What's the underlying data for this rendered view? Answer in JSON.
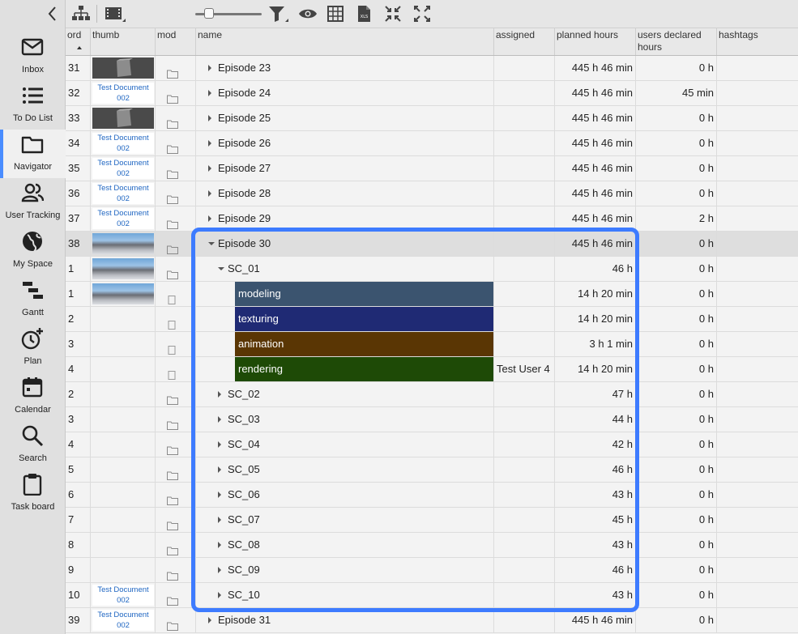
{
  "sidebar": {
    "items": [
      {
        "label": "Inbox",
        "icon": "mail-icon"
      },
      {
        "label": "To Do List",
        "icon": "list-icon"
      },
      {
        "label": "Navigator",
        "icon": "folder-icon",
        "active": true
      },
      {
        "label": "User Tracking",
        "icon": "users-icon"
      },
      {
        "label": "My Space",
        "icon": "globe-icon"
      },
      {
        "label": "Gantt",
        "icon": "gantt-icon"
      },
      {
        "label": "Plan",
        "icon": "clock-plus-icon"
      },
      {
        "label": "Calendar",
        "icon": "calendar-icon"
      },
      {
        "label": "Search",
        "icon": "search-icon"
      },
      {
        "label": "Task board",
        "icon": "clipboard-icon"
      }
    ]
  },
  "toolbar": {
    "icons": [
      "hierarchy-icon",
      "filmstrip-icon",
      "zoom-slider",
      "filter-icon",
      "eye-icon",
      "table-icon",
      "xls-icon",
      "compress-icon",
      "expand-icon"
    ],
    "slider_value": 0.15
  },
  "columns": {
    "ord": "ord",
    "thumb": "thumb",
    "mod": "mod",
    "name": "name",
    "assigned": "assigned",
    "planned": "planned hours",
    "declared_1": "users declared",
    "declared_2": "hours",
    "hashtags": "hashtags"
  },
  "thumb_doc_text": [
    "Test Document",
    "002"
  ],
  "rows": [
    {
      "ord": "31",
      "thumb": "gray",
      "name": "Episode 23",
      "level": 0,
      "exp": "r",
      "assigned": "",
      "planned": "445 h 46 min",
      "declared": "0 h"
    },
    {
      "ord": "32",
      "thumb": "doc",
      "name": "Episode 24",
      "level": 0,
      "exp": "r",
      "assigned": "",
      "planned": "445 h 46 min",
      "declared": "45 min"
    },
    {
      "ord": "33",
      "thumb": "gray",
      "name": "Episode 25",
      "level": 0,
      "exp": "r",
      "assigned": "",
      "planned": "445 h 46 min",
      "declared": "0 h"
    },
    {
      "ord": "34",
      "thumb": "doc",
      "name": "Episode 26",
      "level": 0,
      "exp": "r",
      "assigned": "",
      "planned": "445 h 46 min",
      "declared": "0 h"
    },
    {
      "ord": "35",
      "thumb": "doc",
      "name": "Episode 27",
      "level": 0,
      "exp": "r",
      "assigned": "",
      "planned": "445 h 46 min",
      "declared": "0 h"
    },
    {
      "ord": "36",
      "thumb": "doc",
      "name": "Episode 28",
      "level": 0,
      "exp": "r",
      "assigned": "",
      "planned": "445 h 46 min",
      "declared": "0 h"
    },
    {
      "ord": "37",
      "thumb": "doc",
      "name": "Episode 29",
      "level": 0,
      "exp": "r",
      "assigned": "",
      "planned": "445 h 46 min",
      "declared": "2 h"
    },
    {
      "ord": "38",
      "thumb": "photo",
      "name": "Episode 30",
      "level": 0,
      "exp": "d",
      "assigned": "",
      "planned": "445 h 46 min",
      "declared": "0 h",
      "selected": true
    },
    {
      "ord": "1",
      "thumb": "photo",
      "name": "SC_01",
      "level": 1,
      "exp": "d",
      "assigned": "",
      "planned": "46 h",
      "declared": "0 h"
    },
    {
      "ord": "1",
      "thumb": "photo",
      "name": "modeling",
      "level": 2,
      "task_color": "#3b546f",
      "assigned": "",
      "planned": "14 h 20 min",
      "declared": "0 h"
    },
    {
      "ord": "2",
      "thumb": "",
      "name": "texturing",
      "level": 2,
      "task_color": "#1f2a74",
      "assigned": "",
      "planned": "14 h 20 min",
      "declared": "0 h"
    },
    {
      "ord": "3",
      "thumb": "",
      "name": "animation",
      "level": 2,
      "task_color": "#5a3604",
      "assigned": "",
      "planned": "3 h 1 min",
      "declared": "0 h"
    },
    {
      "ord": "4",
      "thumb": "",
      "name": "rendering",
      "level": 2,
      "task_color": "#1e4a06",
      "assigned": "Test User 4",
      "planned": "14 h 20 min",
      "declared": "0 h"
    },
    {
      "ord": "2",
      "thumb": "",
      "name": "SC_02",
      "level": 1,
      "exp": "r",
      "assigned": "",
      "planned": "47 h",
      "declared": "0 h"
    },
    {
      "ord": "3",
      "thumb": "",
      "name": "SC_03",
      "level": 1,
      "exp": "r",
      "assigned": "",
      "planned": "44 h",
      "declared": "0 h"
    },
    {
      "ord": "4",
      "thumb": "",
      "name": "SC_04",
      "level": 1,
      "exp": "r",
      "assigned": "",
      "planned": "42 h",
      "declared": "0 h"
    },
    {
      "ord": "5",
      "thumb": "",
      "name": "SC_05",
      "level": 1,
      "exp": "r",
      "assigned": "",
      "planned": "46 h",
      "declared": "0 h"
    },
    {
      "ord": "6",
      "thumb": "",
      "name": "SC_06",
      "level": 1,
      "exp": "r",
      "assigned": "",
      "planned": "43 h",
      "declared": "0 h"
    },
    {
      "ord": "7",
      "thumb": "",
      "name": "SC_07",
      "level": 1,
      "exp": "r",
      "assigned": "",
      "planned": "45 h",
      "declared": "0 h"
    },
    {
      "ord": "8",
      "thumb": "",
      "name": "SC_08",
      "level": 1,
      "exp": "r",
      "assigned": "",
      "planned": "43 h",
      "declared": "0 h"
    },
    {
      "ord": "9",
      "thumb": "",
      "name": "SC_09",
      "level": 1,
      "exp": "r",
      "assigned": "",
      "planned": "46 h",
      "declared": "0 h"
    },
    {
      "ord": "10",
      "thumb": "doc",
      "name": "SC_10",
      "level": 1,
      "exp": "r",
      "assigned": "",
      "planned": "43 h",
      "declared": "0 h"
    },
    {
      "ord": "39",
      "thumb": "doc",
      "name": "Episode 31",
      "level": 0,
      "exp": "r",
      "assigned": "",
      "planned": "445 h 46 min",
      "declared": "0 h"
    }
  ],
  "colors": {
    "accent": "#4a8dff",
    "highlight": "#3d7bff"
  }
}
